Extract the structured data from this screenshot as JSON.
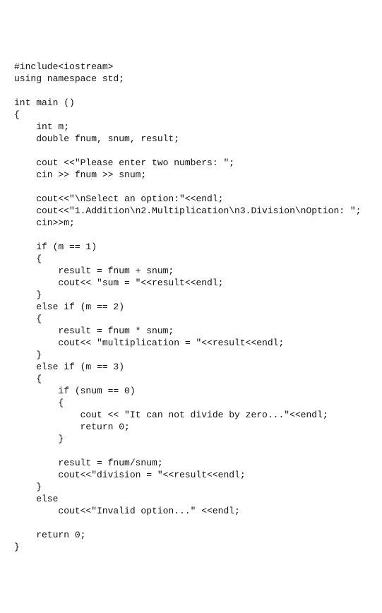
{
  "code": {
    "lines": [
      "#include<iostream>",
      "using namespace std;",
      "",
      "int main ()",
      "{",
      "    int m;",
      "    double fnum, snum, result;",
      "",
      "    cout <<\"Please enter two numbers: \";",
      "    cin >> fnum >> snum;",
      "",
      "    cout<<\"\\nSelect an option:\"<<endl;",
      "    cout<<\"1.Addition\\n2.Multiplication\\n3.Division\\nOption: \";",
      "    cin>>m;",
      "",
      "    if (m == 1)",
      "    {",
      "        result = fnum + snum;",
      "        cout<< \"sum = \"<<result<<endl;",
      "    }",
      "    else if (m == 2)",
      "    {",
      "        result = fnum * snum;",
      "        cout<< \"multiplication = \"<<result<<endl;",
      "    }",
      "    else if (m == 3)",
      "    {",
      "        if (snum == 0)",
      "        {",
      "            cout << \"It can not divide by zero...\"<<endl;",
      "            return 0;",
      "        }",
      "",
      "        result = fnum/snum;",
      "        cout<<\"division = \"<<result<<endl;",
      "    }",
      "    else",
      "        cout<<\"Invalid option...\" <<endl;",
      "",
      "    return 0;",
      "}"
    ]
  }
}
